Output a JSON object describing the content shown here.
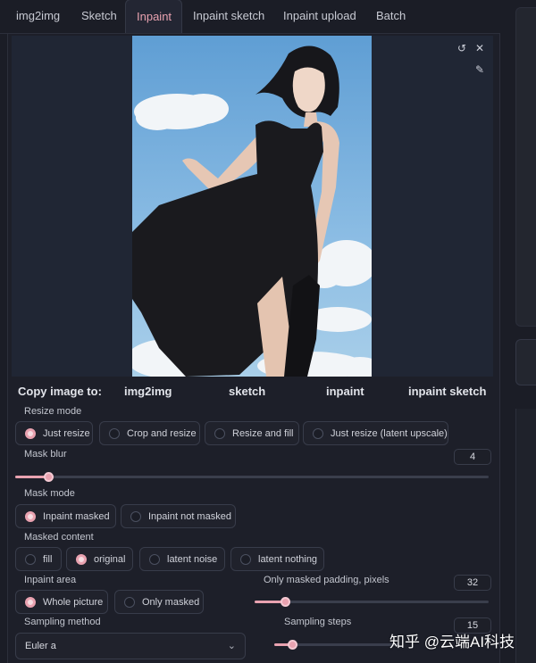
{
  "tabs": [
    {
      "label": "img2img"
    },
    {
      "label": "Sketch"
    },
    {
      "label": "Inpaint"
    },
    {
      "label": "Inpaint sketch"
    },
    {
      "label": "Inpaint upload"
    },
    {
      "label": "Batch"
    }
  ],
  "active_tab": "Inpaint",
  "copy_image": {
    "label": "Copy image to:",
    "targets": [
      "img2img",
      "sketch",
      "inpaint",
      "inpaint sketch"
    ]
  },
  "resize_mode": {
    "label": "Resize mode",
    "options": [
      "Just resize",
      "Crop and resize",
      "Resize and fill",
      "Just resize (latent upscale)"
    ],
    "selected": "Just resize"
  },
  "mask_blur": {
    "label": "Mask blur",
    "value": "4",
    "fraction": 0.07
  },
  "mask_mode": {
    "label": "Mask mode",
    "options": [
      "Inpaint masked",
      "Inpaint not masked"
    ],
    "selected": "Inpaint masked"
  },
  "masked_content": {
    "label": "Masked content",
    "options": [
      "fill",
      "original",
      "latent noise",
      "latent nothing"
    ],
    "selected": "original"
  },
  "inpaint_area": {
    "label": "Inpaint area",
    "options": [
      "Whole picture",
      "Only masked"
    ],
    "selected": "Whole picture"
  },
  "padding": {
    "label": "Only masked padding, pixels",
    "value": "32",
    "fraction": 0.13
  },
  "sampling_method": {
    "label": "Sampling method",
    "value": "Euler a"
  },
  "sampling_steps": {
    "label": "Sampling steps",
    "value": "15",
    "fraction": 0.14
  },
  "watermark": "知乎 @云端AI科技",
  "colors": {
    "accent": "#e9a2b0",
    "background": "#1b1d26",
    "sky": "#7fb3dd"
  }
}
